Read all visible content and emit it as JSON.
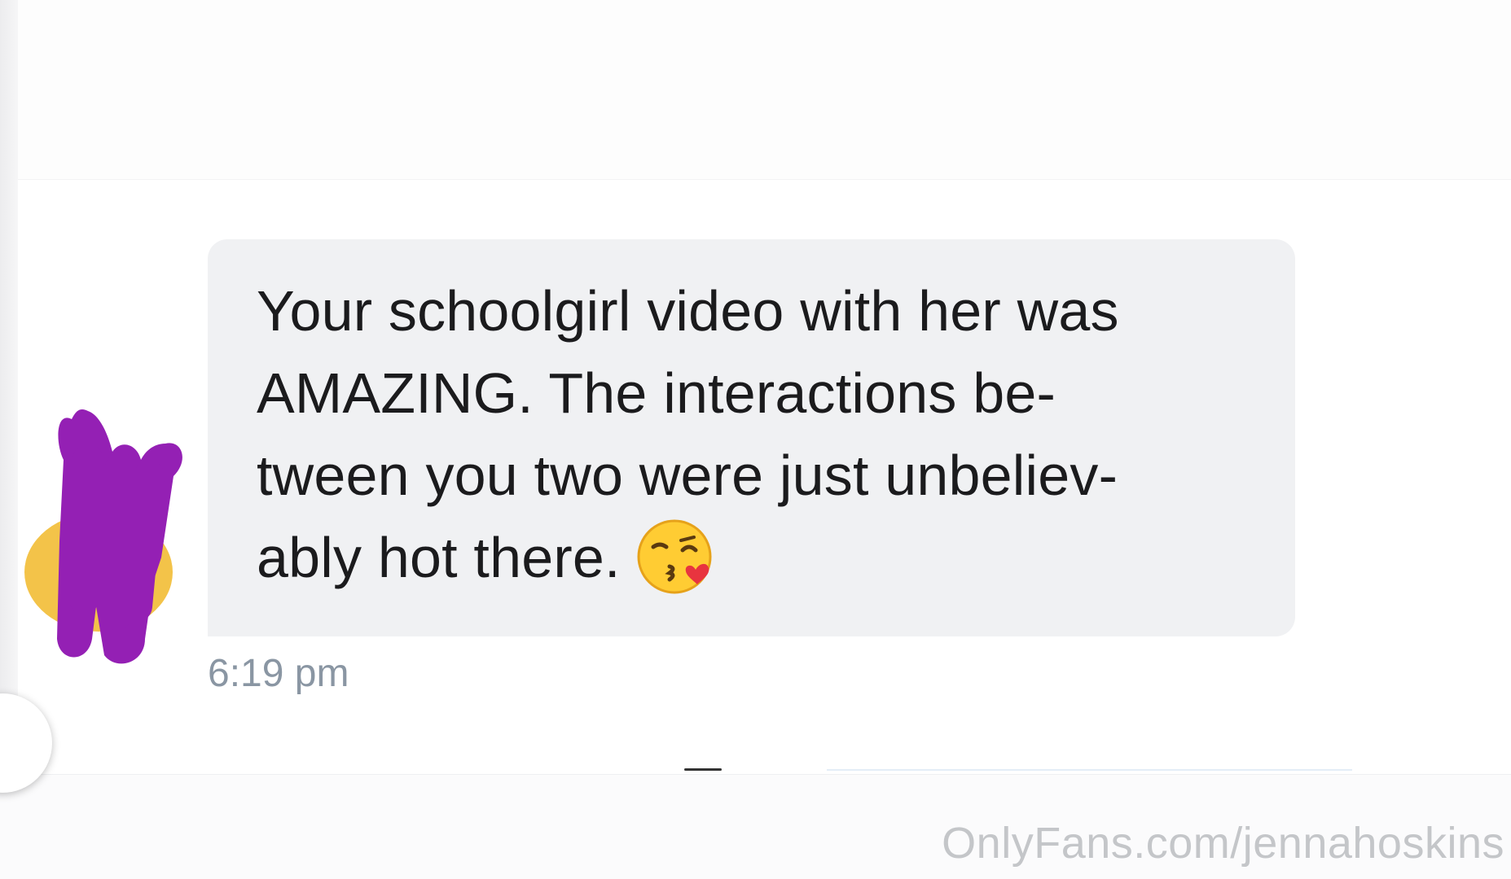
{
  "message": {
    "line1": "Your schoolgirl video with her was",
    "line2": "AMAZING. The interactions be-",
    "line3": "tween you two were just unbeliev-",
    "line4": "ably hot there.",
    "emoji": "kissing-face-wink-heart-icon",
    "timestamp": "6:19 pm"
  },
  "avatar": {
    "color": "#f3c349",
    "redaction_color": "#9420b4"
  },
  "watermark": {
    "text": "OnlyFans.com/jennahoskins"
  },
  "colors": {
    "bubble": "#f0f1f3",
    "timestamp": "#8a96a3"
  }
}
